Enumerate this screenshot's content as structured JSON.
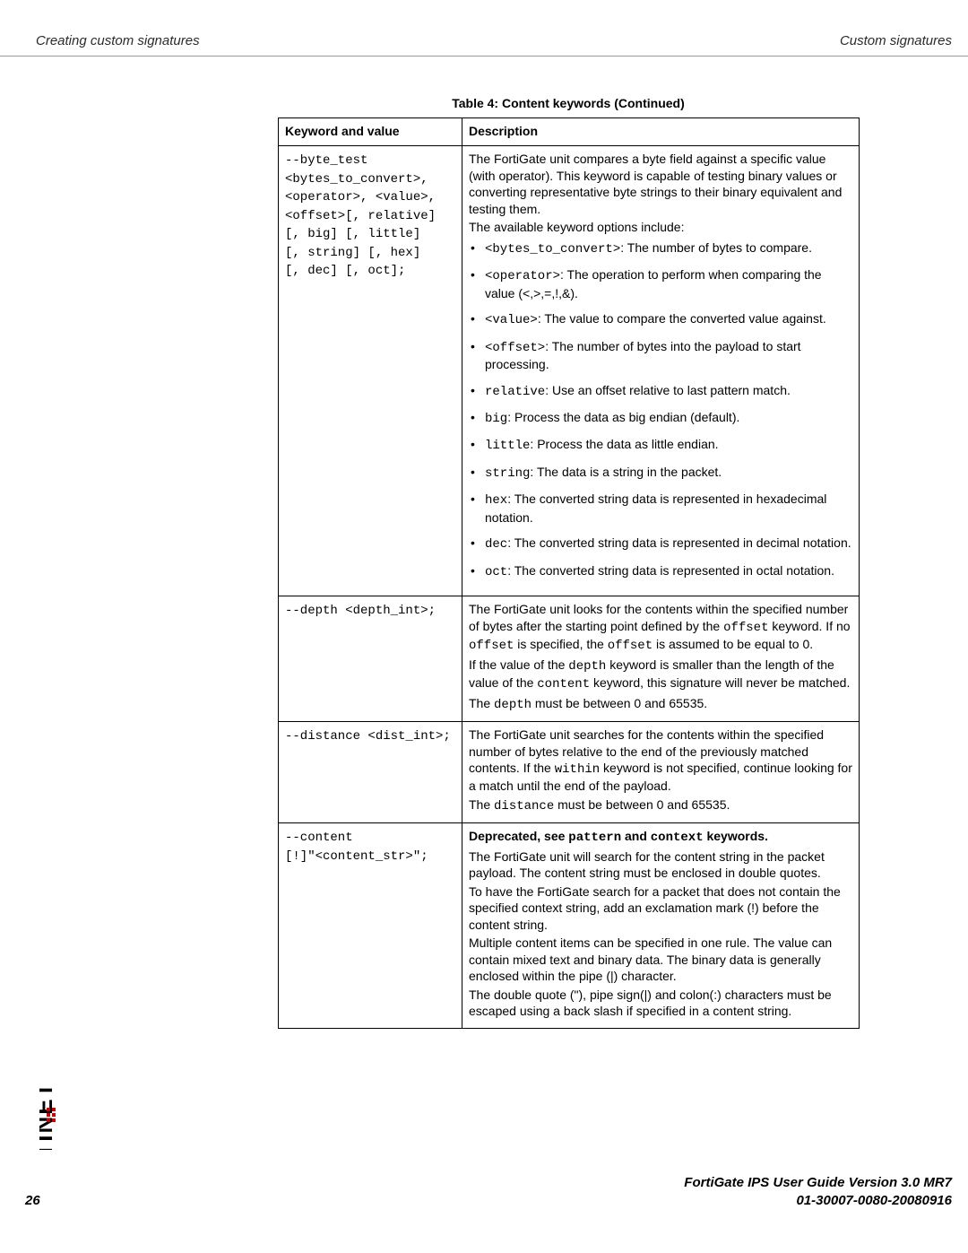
{
  "header": {
    "left": "Creating custom signatures",
    "right": "Custom signatures"
  },
  "brand_letters": "FORTINET",
  "caption": "Table 4: Content keywords (Continued)",
  "columns": {
    "kw": "Keyword and value",
    "desc": "Description"
  },
  "rows": {
    "byte_test": {
      "keyword": "--byte_test\n<bytes_to_convert>,\n<operator>, <value>,\n<offset>[, relative]\n[, big] [, little]\n[, string] [, hex]\n[, dec] [, oct];",
      "intro1": "The FortiGate unit compares a byte field against a specific value (with operator). This keyword is capable of testing binary values or converting representative byte strings to their binary equivalent and testing them.",
      "intro2": "The available keyword options include:",
      "opts": [
        {
          "k": "<bytes_to_convert>",
          "t": ": The number of bytes to compare."
        },
        {
          "k": "<operator>",
          "t": ": The operation to perform when comparing the value (<,>,=,!,&)."
        },
        {
          "k": "<value>",
          "t": ": The value to compare the converted value against."
        },
        {
          "k": "<offset>",
          "t": ": The number of bytes into the payload to start processing."
        },
        {
          "k": "relative",
          "t": ": Use an offset relative to last pattern match."
        },
        {
          "k": "big",
          "t": ": Process the data as big endian (default)."
        },
        {
          "k": "little",
          "t": ": Process the data as little endian."
        },
        {
          "k": "string",
          "t": ": The data is a string in the packet."
        },
        {
          "k": "hex",
          "t": ": The converted string data is represented in hexadecimal notation."
        },
        {
          "k": "dec",
          "t": ": The converted string data is represented in decimal notation."
        },
        {
          "k": "oct",
          "t": ": The converted string data is represented in octal notation."
        }
      ]
    },
    "depth": {
      "keyword": "--depth <depth_int>;",
      "p1a": "The FortiGate unit looks for the contents within the specified number of bytes after the starting point defined by the ",
      "p1b": "offset",
      "p1c": " keyword. If no ",
      "p1d": "offset",
      "p1e": " is specified, the ",
      "p1f": "offset",
      "p1g": " is assumed to be equal to 0.",
      "p2a": "If the value of the ",
      "p2b": "depth",
      "p2c": " keyword is smaller than the length of the value of the ",
      "p2d": "content",
      "p2e": " keyword, this signature will never be matched.",
      "p3a": "The ",
      "p3b": "depth",
      "p3c": " must be between 0 and 65535."
    },
    "distance": {
      "keyword": "--distance <dist_int>;",
      "p1a": "The FortiGate unit searches for the contents within the specified number of bytes relative to the end of the previously matched contents. If the ",
      "p1b": "within",
      "p1c": " keyword is not specified, continue looking for a match until the end of the payload.",
      "p2a": "The ",
      "p2b": "distance",
      "p2c": " must be between 0 and 65535."
    },
    "content": {
      "keyword": "--content\n[!]\"<content_str>\";",
      "d1a": "Deprecated, see ",
      "d1b": "pattern",
      "d1c": " and ",
      "d1d": "context",
      "d1e": " keywords.",
      "p2": "The FortiGate unit will search for the content string in the packet payload. The content string must be enclosed in double quotes.",
      "p3": "To have the FortiGate search for a packet that does not contain the specified context string, add an exclamation mark (!) before the content string.",
      "p4": "Multiple content items can be specified in one rule. The value can contain mixed text and binary data. The binary data is generally enclosed within the pipe (|) character.",
      "p5": "The double quote (\"), pipe sign(|) and colon(:) characters must be escaped using a back slash if specified in a content string."
    }
  },
  "footer": {
    "line1": "FortiGate IPS User Guide Version 3.0 MR7",
    "line2": "01-30007-0080-20080916",
    "page": "26"
  }
}
